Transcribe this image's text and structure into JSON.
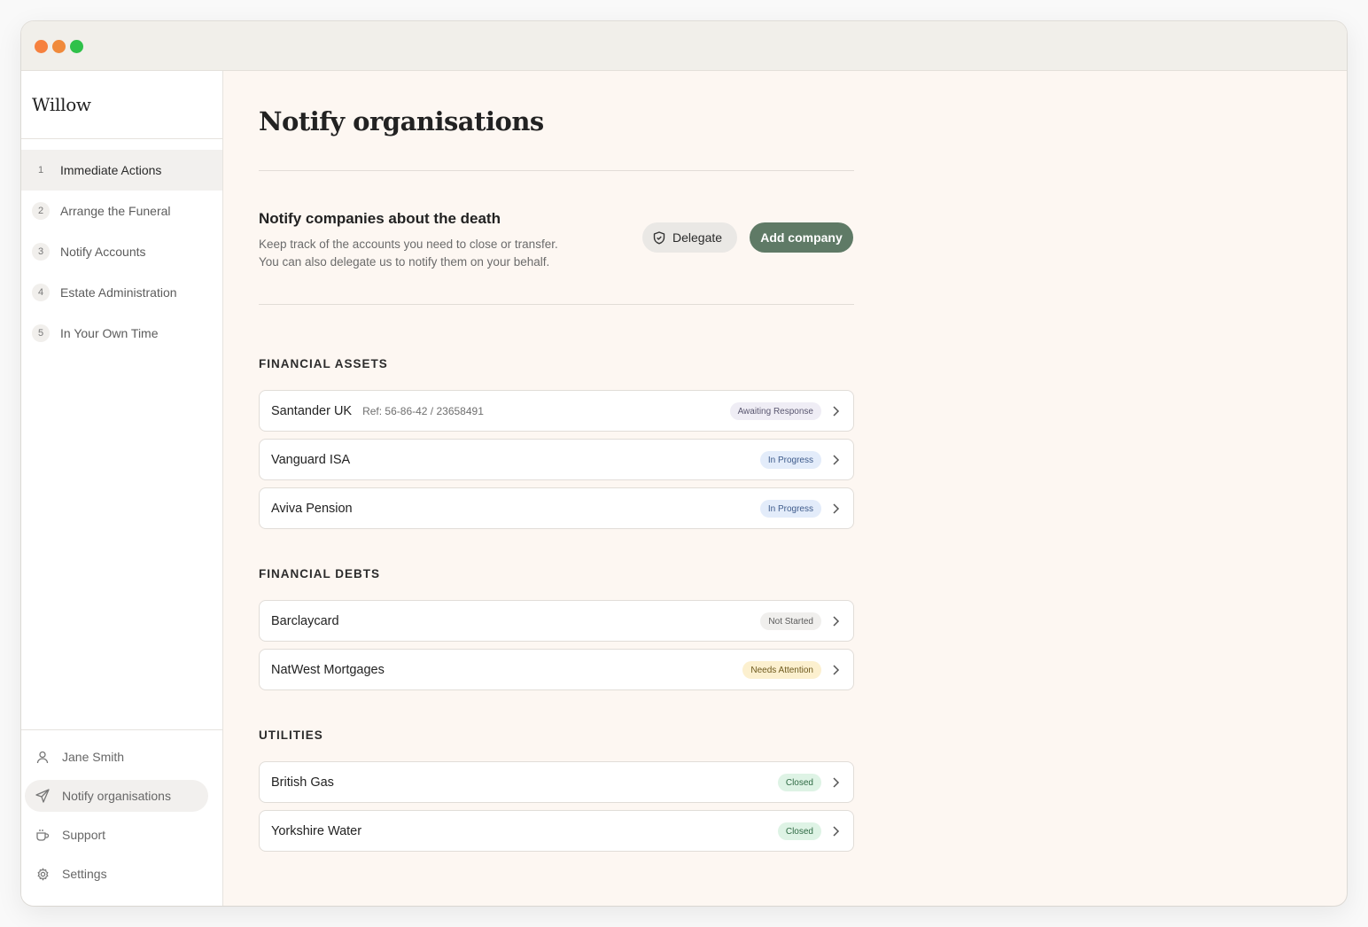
{
  "app": {
    "brand": "Willow"
  },
  "sidebar": {
    "steps": [
      {
        "num": "1",
        "label": "Immediate Actions",
        "active": true
      },
      {
        "num": "2",
        "label": "Arrange the Funeral"
      },
      {
        "num": "3",
        "label": "Notify Accounts"
      },
      {
        "num": "4",
        "label": "Estate Administration"
      },
      {
        "num": "5",
        "label": "In Your Own Time"
      }
    ],
    "bottom": [
      {
        "label": "Jane Smith",
        "icon": "user-icon"
      },
      {
        "label": "Notify organisations",
        "icon": "send-icon",
        "active": true
      },
      {
        "label": "Support",
        "icon": "mug-icon"
      },
      {
        "label": "Settings",
        "icon": "gear-icon"
      }
    ]
  },
  "main": {
    "title": "Notify organisations",
    "section": {
      "title": "Notify companies about the death",
      "desc_line1": "Keep track of the accounts you need to close or transfer.",
      "desc_line2": "You can also delegate us to notify them on your behalf.",
      "delegate_label": "Delegate",
      "add_label": "Add company"
    },
    "categories": [
      {
        "label": "FINANCIAL ASSETS",
        "items": [
          {
            "name": "Santander UK",
            "ref": "Ref: 56-86-42 / 23658491",
            "status": "Awaiting Response"
          },
          {
            "name": "Vanguard ISA",
            "ref": "",
            "status": "In Progress"
          },
          {
            "name": "Aviva Pension",
            "ref": "",
            "status": "In Progress"
          }
        ]
      },
      {
        "label": "FINANCIAL DEBTS",
        "items": [
          {
            "name": "Barclaycard",
            "ref": "",
            "status": "Not Started"
          },
          {
            "name": "NatWest Mortgages",
            "ref": "",
            "status": "Needs Attention"
          }
        ]
      },
      {
        "label": "UTILITIES",
        "items": [
          {
            "name": "British Gas",
            "ref": "",
            "status": "Closed"
          },
          {
            "name": "Yorkshire Water",
            "ref": "",
            "status": "Closed"
          }
        ]
      }
    ]
  },
  "colors": {
    "accent": "#5f7a66",
    "page_bg": "#fdf7f2",
    "badge_awaiting_bg": "#efedf5",
    "badge_awaiting_fg": "#5a5770",
    "badge_progress_bg": "#e3ecfa",
    "badge_progress_fg": "#3d5a8a",
    "badge_notstarted_bg": "#f0efed",
    "badge_notstarted_fg": "#5b5b5b",
    "badge_attention_bg": "#fcf0cf",
    "badge_attention_fg": "#6e5a1e",
    "badge_closed_bg": "#def3e5",
    "badge_closed_fg": "#2f6a44"
  }
}
